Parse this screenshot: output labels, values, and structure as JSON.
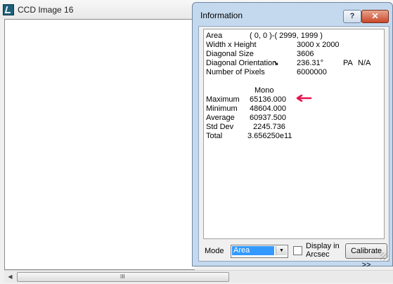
{
  "ccd": {
    "title": "CCD Image 16",
    "scroll_left": "◀",
    "scroll_grip": "III"
  },
  "info": {
    "title": "Information",
    "help_label": "?",
    "close_label": "✕",
    "fields": {
      "area": {
        "label": "Area",
        "value": "( 0, 0 )-( 2999, 1999 )"
      },
      "size": {
        "label": "Width x Height",
        "value": "3000 x 2000"
      },
      "diagonal": {
        "label": "Diagonal Size",
        "value": "3606"
      },
      "orientation": {
        "label": "Diagonal Orientation",
        "value": "236.31°",
        "pa_label": "PA",
        "pa_value": "N/A",
        "arrow": "➘"
      },
      "pixels": {
        "label": "Number of Pixels",
        "value": "6000000"
      }
    },
    "stats_heading": "Mono",
    "stats": {
      "maximum": {
        "label": "Maximum",
        "value": "65136.000"
      },
      "minimum": {
        "label": "Minimum",
        "value": "48604.000"
      },
      "average": {
        "label": "Average",
        "value": "60937.500"
      },
      "stddev": {
        "label": "Std Dev",
        "value": "2245.736"
      },
      "total": {
        "label": "Total",
        "value": "3.656250e11"
      }
    },
    "mode_label": "Mode",
    "mode_value": "Area",
    "mode_drop": "▼",
    "arcsec_label": "Display in Arcsec",
    "arcsec_checked": false,
    "calibrate_label": "Calibrate >>",
    "annotation_color": "#e8144a"
  }
}
